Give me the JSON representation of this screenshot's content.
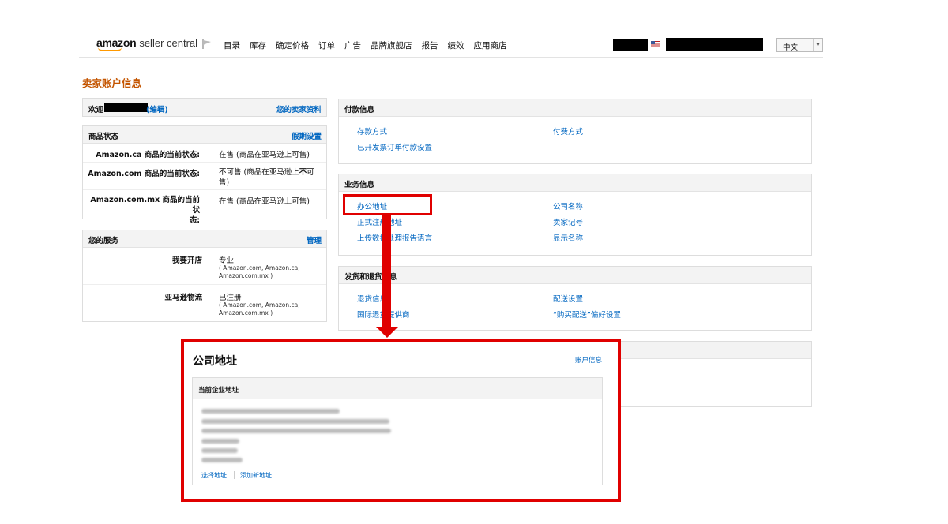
{
  "header": {
    "logo_amazon": "amazon",
    "logo_seller_central": "seller central",
    "nav": [
      "目录",
      "库存",
      "确定价格",
      "订单",
      "广告",
      "品牌旗舰店",
      "报告",
      "绩效",
      "应用商店"
    ],
    "language": "中文"
  },
  "page_title": "卖家账户信息",
  "welcome": {
    "prefix": "欢迎",
    "edit_label": "(编辑)",
    "profile_link": "您的卖家资料"
  },
  "listing_status": {
    "title": "商品状态",
    "action": "假期设置",
    "rows": [
      {
        "label": "Amazon.ca 商品的当前状态:",
        "value": "在售 (商品在亚马逊上可售)"
      },
      {
        "label": "Amazon.com 商品的当前状态:",
        "value_a": "不可售 (商品在亚马逊上",
        "value_b": "不",
        "value_c": "可",
        "value_d": "售)"
      },
      {
        "label_a": "Amazon.com.mx 商品的当前状",
        "label_b": "态:",
        "value": "在售 (商品在亚马逊上可售)"
      }
    ]
  },
  "services": {
    "title": "您的服务",
    "action": "管理",
    "rows": [
      {
        "label": "我要开店",
        "value": "专业",
        "detail_a": "( Amazon.com, Amazon.ca,",
        "detail_b": "Amazon.com.mx )"
      },
      {
        "label": "亚马逊物流",
        "value": "已注册",
        "detail_a": "( Amazon.com, Amazon.ca,",
        "detail_b": "Amazon.com.mx )"
      }
    ]
  },
  "payment_info": {
    "title": "付款信息",
    "links": [
      "存款方式",
      "付费方式",
      "已开发票订单付款设置"
    ]
  },
  "business_info": {
    "title": "业务信息",
    "links": [
      "办公地址",
      "公司名称",
      "正式注册地址",
      "卖家记号",
      "上传数据处理报告语言",
      "显示名称"
    ]
  },
  "shipping_returns": {
    "title": "发货和退货信息",
    "links": [
      "退货信息",
      "配送设置",
      "国际退货提供商",
      "“购买配送”偏好设置"
    ]
  },
  "popup": {
    "title": "公司地址",
    "account_link": "账户信息",
    "section_title": "当前企业地址",
    "select_address": "选择地址",
    "add_address": "添加新地址"
  },
  "colors": {
    "title_orange": "#c45500",
    "link_blue": "#0066c0",
    "highlight_red": "#e00000"
  }
}
